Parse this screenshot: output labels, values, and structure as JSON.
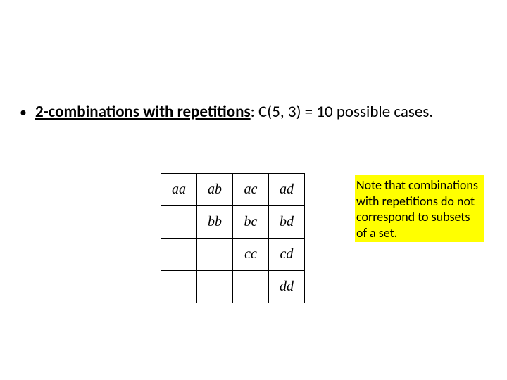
{
  "bullet": {
    "marker": "•",
    "bold_underlined": "2-combinations with  repetitions",
    "rest": ": C(5, 3) = 10 possible cases."
  },
  "table": {
    "rows": [
      [
        "aa",
        "ab",
        "ac",
        "ad"
      ],
      [
        "",
        "bb",
        "bc",
        "bd"
      ],
      [
        "",
        "",
        "cc",
        "cd"
      ],
      [
        "",
        "",
        "",
        "dd"
      ]
    ]
  },
  "note": {
    "text": "Note that combinations with repetitions do not correspond to subsets of a set."
  }
}
